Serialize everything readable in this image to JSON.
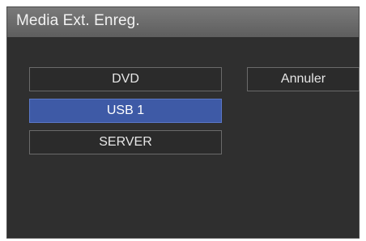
{
  "dialog": {
    "title": "Media Ext. Enreg.",
    "options": [
      {
        "label": "DVD"
      },
      {
        "label": "USB 1",
        "selected": true
      },
      {
        "label": "SERVER"
      }
    ],
    "cancel_label": "Annuler"
  },
  "colors": {
    "panel_bg": "#2f2f2f",
    "title_bg": "#6b6b6b",
    "selected_bg": "#3e5aa6",
    "button_border": "#6a6a6a",
    "text": "#e6e6e6"
  }
}
